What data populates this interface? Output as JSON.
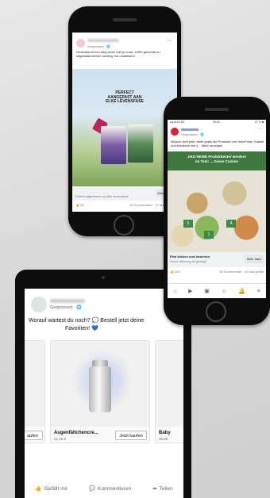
{
  "phone1": {
    "sponsored": "Gesponsert · 🌐",
    "post_text": "Ondersteunt een lang leven met je hond: 100% gezonde en uitgebalanceerde voeding. Nu ontdekken!",
    "ad_headline_1": "PERFECT",
    "ad_headline_2": "AANGEPAST AAN",
    "ad_headline_3": "ELKE LEVENSFASE",
    "cta_sub": "Perfect afgestemd op elke levensfase",
    "cta_button": "Meer meer",
    "stats_left": "👍 65",
    "stats_right": "35 Kommentare · 17 Mal geteilt",
    "more_icon": "···"
  },
  "phone2": {
    "status_left": "●● ALDI DE",
    "status_center": "09:42",
    "status_right": "97 % ■",
    "sponsored": "Gesponsert · 🌐",
    "post_text": "Besuch dich jetzt, teste gratis die Produkte von HelloFresh Gobble und entdecke wie s... Mehr anzeigen",
    "banner_line1": "Jetzt REWE Produkttester werden!",
    "banner_line2": "Im Test: ... Green Cuisine",
    "chips": [
      "5",
      "1",
      "4"
    ],
    "cta_title": "Film klicken und bewerten",
    "cta_sub": "Deine Meinung ist gefragt",
    "cta_button": "Mehr dazu",
    "stats_left": "👍 403",
    "stats_right": "34 Kommentare · 23 mal geteilt",
    "more_icon": "···",
    "nav": [
      "⌂",
      "▶",
      "▣",
      "☺",
      "🔔",
      "≡"
    ]
  },
  "tablet": {
    "sponsored": "Gesponsert · 🌐",
    "post_line1": "Worauf wartest du noch? 💭 Bestell jetzt deine",
    "post_line2": "Favoriten! 💙",
    "cards": [
      {
        "label": "",
        "price": "",
        "button": "aufen"
      },
      {
        "label": "Augenfältchencre...",
        "price": "21,16 €",
        "button": "Jetzt kaufen"
      },
      {
        "label": "Baby",
        "price": "36,65",
        "button": ""
      }
    ],
    "actions": [
      "Gefällt mir",
      "Kommentieren",
      "Teilen"
    ]
  }
}
